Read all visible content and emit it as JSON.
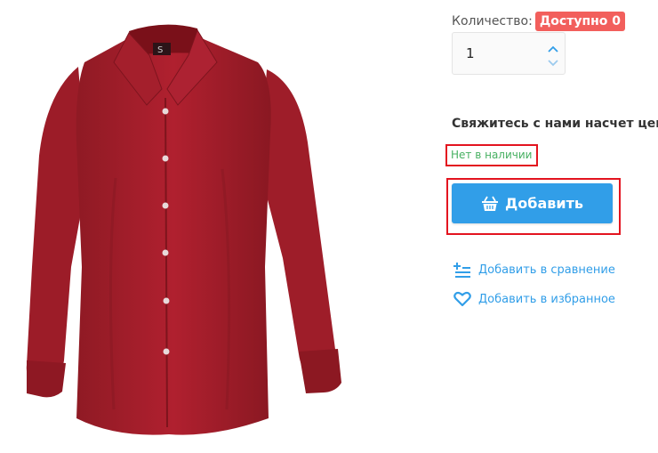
{
  "product": {
    "image_alt": "Красная рубашка с длинным рукавом",
    "collar_label_text": "S"
  },
  "quantity": {
    "label": "Количество:",
    "available_badge": "Доступно 0",
    "value": "1"
  },
  "price_contact": "Свяжитесь с нами насчет цены",
  "availability": "Нет в наличии",
  "add_button": {
    "label": "Добавить",
    "icon": "basket-icon"
  },
  "links": {
    "compare": {
      "label": "Добавить в сравнение",
      "icon": "compare-list-icon"
    },
    "favorite": {
      "label": "Добавить в избранное",
      "icon": "heart-icon"
    }
  },
  "colors": {
    "accent": "#319ee8",
    "badge": "#f25f5c",
    "availability": "#46b061",
    "highlight_frame": "#e3141f",
    "shirt": "#a71e2b"
  }
}
